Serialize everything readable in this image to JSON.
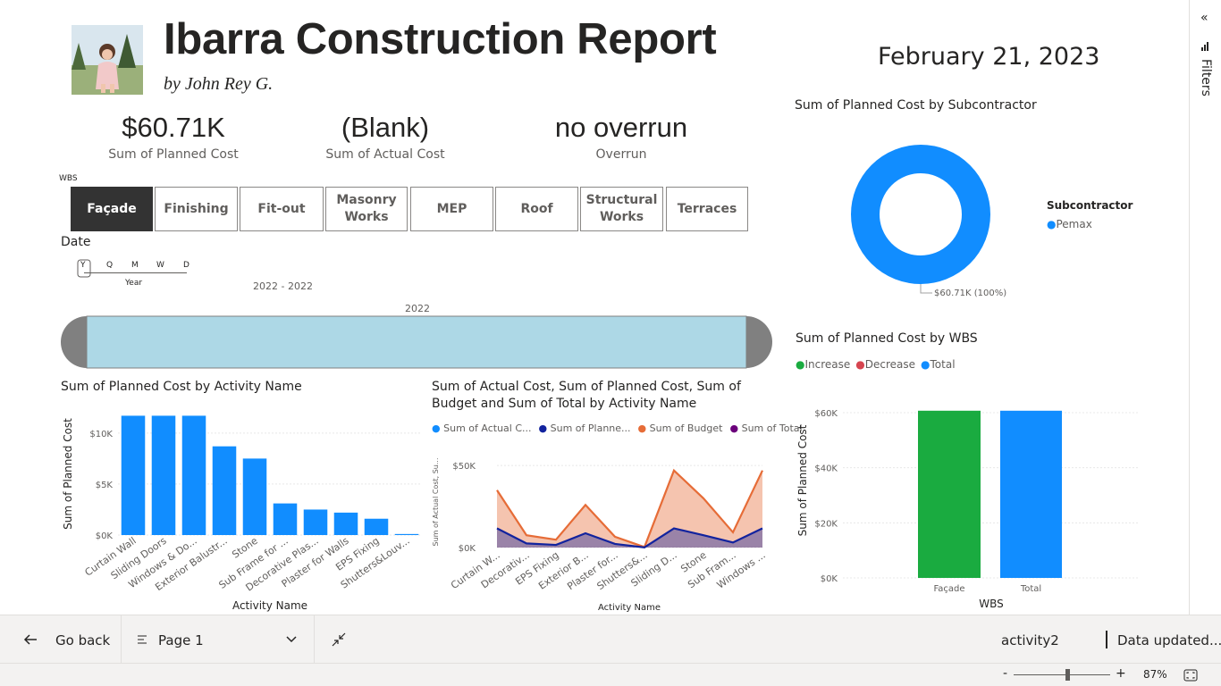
{
  "header": {
    "title": "Ibarra Construction Report",
    "subtitle": "by John Rey G.",
    "date": "February 21, 2023"
  },
  "cards": [
    {
      "value": "$60.71K",
      "label": "Sum of Planned Cost"
    },
    {
      "value": "(Blank)",
      "label": "Sum of Actual Cost"
    },
    {
      "value": "no overrun",
      "label": "Overrun"
    }
  ],
  "wbs_slicer": {
    "title": "WBS",
    "buttons": [
      "Façade",
      "Finishing",
      "Fit-out",
      "Masonry Works",
      "MEP",
      "Roof",
      "Structural Works",
      "Terraces"
    ],
    "selected": "Façade"
  },
  "date_slicer": {
    "title": "Date",
    "levels": [
      "Y",
      "Q",
      "M",
      "W",
      "D"
    ],
    "level_label": "Year",
    "range_label": "2022 - 2022",
    "bar_label": "2022"
  },
  "donut": {
    "title": "Sum of Planned Cost by Subcontractor",
    "legend_title": "Subcontractor",
    "legend_items": [
      {
        "name": "Pemax",
        "color": "#118dff"
      }
    ],
    "data_label": "$60.71K (100%)",
    "color": "#118dff",
    "slices": [
      {
        "name": "Pemax",
        "value": 60.71,
        "percent": 100
      }
    ]
  },
  "waterfall": {
    "title": "Sum of Planned Cost by WBS",
    "legend": [
      {
        "name": "Increase",
        "color": "#1aab40"
      },
      {
        "name": "Decrease",
        "color": "#d64550"
      },
      {
        "name": "Total",
        "color": "#118dff"
      }
    ]
  },
  "bar_chart": {
    "title": "Sum of Planned Cost by Activity Name"
  },
  "area_chart": {
    "title_line1": "Sum of Actual Cost, Sum of Planned Cost, Sum of",
    "title_line2": "Budget and Sum of Total by Activity Name",
    "legend": [
      {
        "name": "Sum of Actual C...",
        "color": "#118dff"
      },
      {
        "name": "Sum of Planne...",
        "color": "#12239e"
      },
      {
        "name": "Sum of Budget",
        "color": "#e66c37"
      },
      {
        "name": "Sum of Total",
        "color": "#6b007b"
      }
    ]
  },
  "chart_data": [
    {
      "type": "bar",
      "title": "Sum of Planned Cost by Activity Name",
      "xlabel": "Activity Name",
      "ylabel": "Sum of Planned Cost",
      "categories": [
        "Curtain Wall",
        "Sliding Doors",
        "Windows & Do...",
        "Exterior Balustr...",
        "Stone",
        "Sub Frame for ...",
        "Decorative Plas...",
        "Plaster for Walls",
        "EPS Fixing",
        "Shutters&Louv..."
      ],
      "values": [
        11700,
        11700,
        11700,
        8700,
        7500,
        3100,
        2500,
        2200,
        1600,
        100
      ],
      "yticks": [
        "$0K",
        "$5K",
        "$10K"
      ],
      "ylim": [
        0,
        12000
      ],
      "color": "#118dff"
    },
    {
      "type": "area",
      "title": "Sum of Actual Cost, Sum of Planned Cost, Sum of Budget and Sum of Total by Activity Name",
      "xlabel": "Activity Name",
      "ylabel": "Sum of Actual Cost, Su...",
      "categories": [
        "Curtain W...",
        "Decorativ...",
        "EPS Fixing",
        "Exterior B...",
        "Plaster for...",
        "Shutters&...",
        "Sliding D...",
        "Stone",
        "Sub Fram...",
        "Windows ..."
      ],
      "yticks": [
        "$0K",
        "$50K"
      ],
      "ylim": [
        0,
        55000
      ],
      "series": [
        {
          "name": "Sum of Actual Cost",
          "values": [
            null,
            null,
            null,
            null,
            null,
            null,
            null,
            null,
            null,
            null
          ],
          "color": "#118dff"
        },
        {
          "name": "Sum of Planned Cost",
          "values": [
            11700,
            2500,
            1600,
            8700,
            2200,
            100,
            11700,
            7500,
            3100,
            11700
          ],
          "color": "#12239e"
        },
        {
          "name": "Sum of Budget",
          "values": [
            35000,
            7500,
            4800,
            26000,
            6600,
            300,
            47000,
            30000,
            9300,
            47000
          ],
          "color": "#e66c37"
        },
        {
          "name": "Sum of Total",
          "values": [
            null,
            null,
            null,
            null,
            null,
            null,
            null,
            null,
            null,
            null
          ],
          "color": "#6b007b"
        }
      ]
    },
    {
      "type": "bar",
      "title": "Sum of Planned Cost by WBS",
      "xlabel": "WBS",
      "ylabel": "Sum of Planned Cost",
      "categories": [
        "Façade",
        "Total"
      ],
      "values": [
        60710,
        60710
      ],
      "colors": [
        "#1aab40",
        "#118dff"
      ],
      "yticks": [
        "$0K",
        "$20K",
        "$40K",
        "$60K"
      ],
      "ylim": [
        0,
        60000
      ]
    }
  ],
  "filters_pane": {
    "label": "Filters"
  },
  "navbar": {
    "back_label": "Go back",
    "page_label": "Page 1",
    "dataset": "activity2",
    "updated": "Data updated..."
  },
  "statusbar": {
    "zoom": "87%",
    "zoom_out": "-",
    "zoom_in": "+",
    "zoom_level": 0.56
  }
}
